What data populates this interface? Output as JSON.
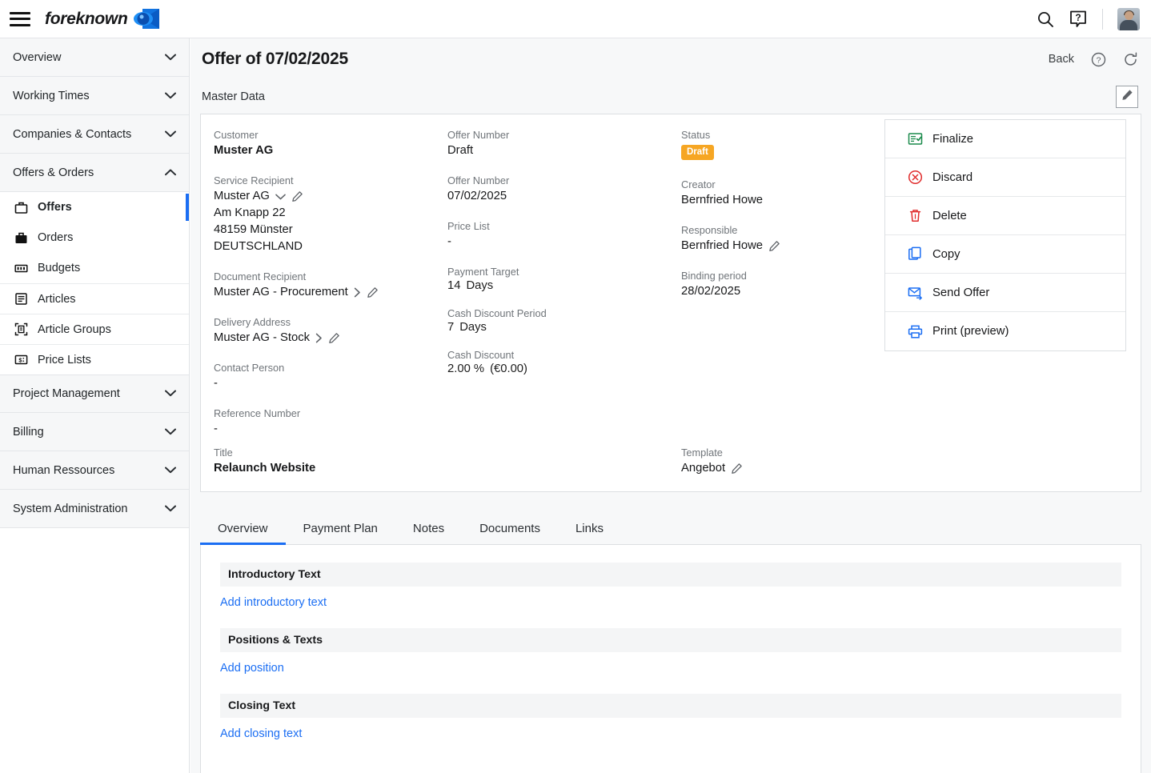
{
  "topbar": {
    "menu_icon": "hamburger-icon",
    "brand": "foreknown",
    "brand_mark": "foreknown-logo",
    "search_icon": "search-icon",
    "help_icon": "help-icon",
    "avatar": "user-avatar"
  },
  "sidebar": {
    "groups": [
      {
        "label": "Overview",
        "expanded": false
      },
      {
        "label": "Working Times",
        "expanded": false
      },
      {
        "label": "Companies & Contacts",
        "expanded": false
      },
      {
        "label": "Offers & Orders",
        "expanded": true
      },
      {
        "label": "Project Management",
        "expanded": false
      },
      {
        "label": "Billing",
        "expanded": false
      },
      {
        "label": "Human Ressources",
        "expanded": false
      },
      {
        "label": "System Administration",
        "expanded": false
      }
    ],
    "offers_orders_items": [
      {
        "label": "Offers",
        "icon": "briefcase-outline-icon",
        "active": true
      },
      {
        "label": "Orders",
        "icon": "briefcase-filled-icon",
        "active": false
      },
      {
        "label": "Budgets",
        "icon": "banknote-icon",
        "active": false
      },
      {
        "label": "Articles",
        "icon": "article-icon",
        "active": false
      },
      {
        "label": "Article Groups",
        "icon": "article-group-icon",
        "active": false
      },
      {
        "label": "Price Lists",
        "icon": "price-list-icon",
        "active": false
      }
    ]
  },
  "page": {
    "title": "Offer of 07/02/2025",
    "back_label": "Back",
    "help_icon": "question-circle-icon",
    "refresh_icon": "refresh-icon",
    "section_label": "Master Data",
    "edit_icon": "pencil-icon"
  },
  "master_data": {
    "col1": {
      "customer_label": "Customer",
      "customer_value": "Muster AG",
      "service_recipient_label": "Service Recipient",
      "service_recipient_value": "Muster AG",
      "address_line1": "Am Knapp 22",
      "address_line2": "48159 Münster",
      "address_line3": "DEUTSCHLAND",
      "document_recipient_label": "Document Recipient",
      "document_recipient_value": "Muster AG - Procurement",
      "delivery_address_label": "Delivery Address",
      "delivery_address_value": "Muster AG - Stock",
      "contact_person_label": "Contact Person",
      "contact_person_value": "-",
      "reference_number_label": "Reference Number",
      "reference_number_value": "-",
      "title_label": "Title",
      "title_value": "Relaunch Website"
    },
    "col2": {
      "offer_number_label": "Offer Number",
      "offer_number_value": "Draft",
      "offer_date_label": "Offer Number",
      "offer_date_value": "07/02/2025",
      "price_list_label": "Price List",
      "price_list_value": "-",
      "payment_target_label": "Payment Target",
      "payment_target_value": "14",
      "payment_target_unit": "Days",
      "cash_discount_period_label": "Cash Discount Period",
      "cash_discount_period_value": "7",
      "cash_discount_period_unit": "Days",
      "cash_discount_label": "Cash Discount",
      "cash_discount_value": "2.00 %",
      "cash_discount_amount": "(€0.00)"
    },
    "col3": {
      "status_label": "Status",
      "status_value": "Draft",
      "status_color": "#f6a623",
      "creator_label": "Creator",
      "creator_value": "Bernfried Howe",
      "responsible_label": "Responsible",
      "responsible_value": "Bernfried Howe",
      "binding_period_label": "Binding period",
      "binding_period_value": "28/02/2025",
      "template_label": "Template",
      "template_value": "Angebot"
    }
  },
  "actions": [
    {
      "label": "Finalize",
      "icon": "document-check-icon",
      "color": "#1a8a4b"
    },
    {
      "label": "Discard",
      "icon": "circle-x-icon",
      "color": "#e02b2b"
    },
    {
      "label": "Delete",
      "icon": "trash-icon",
      "color": "#e02b2b"
    },
    {
      "label": "Copy",
      "icon": "copy-icon",
      "color": "#1b6ef3"
    },
    {
      "label": "Send Offer",
      "icon": "send-mail-icon",
      "color": "#1b6ef3"
    },
    {
      "label": "Print (preview)",
      "icon": "printer-icon",
      "color": "#1b6ef3"
    }
  ],
  "tabs": [
    {
      "label": "Overview",
      "active": true
    },
    {
      "label": "Payment Plan",
      "active": false
    },
    {
      "label": "Notes",
      "active": false
    },
    {
      "label": "Documents",
      "active": false
    },
    {
      "label": "Links",
      "active": false
    }
  ],
  "overview_sections": [
    {
      "heading": "Introductory Text",
      "link": "Add introductory text"
    },
    {
      "heading": "Positions & Texts",
      "link": "Add position"
    },
    {
      "heading": "Closing Text",
      "link": "Add closing text"
    }
  ],
  "colors": {
    "accent": "#1b6ef3",
    "status_draft": "#f6a623",
    "danger": "#e02b2b",
    "success": "#1a8a4b"
  }
}
